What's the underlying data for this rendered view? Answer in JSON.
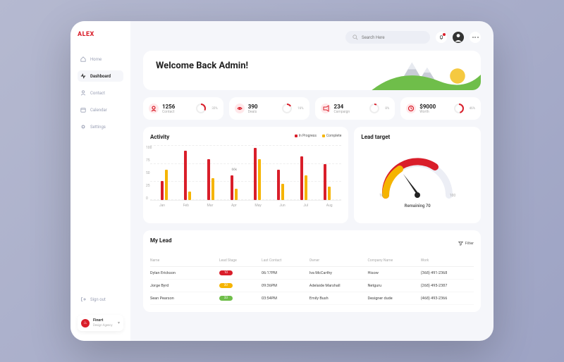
{
  "brand": "ALEX",
  "nav": {
    "home": "Home",
    "dashboard": "Dashboard",
    "contact": "Contact",
    "calendar": "Calendar",
    "settings": "Settings",
    "signout": "Sign out"
  },
  "agency": {
    "name": "Finsrt",
    "sub": "Design Agency"
  },
  "search": {
    "placeholder": "Search Here"
  },
  "hero": {
    "title": "Welcome Back Admin!"
  },
  "stats": [
    {
      "value": "1256",
      "label": "Contact",
      "pct": "32%"
    },
    {
      "value": "390",
      "label": "Deals",
      "pct": "16%"
    },
    {
      "value": "234",
      "label": "Campaign",
      "pct": "8%"
    },
    {
      "value": "$9000",
      "label": "Worth",
      "pct": "46%"
    }
  ],
  "activity": {
    "title": "Activity",
    "legend": {
      "a": "In Progress",
      "b": "Complete"
    },
    "tip": "66k"
  },
  "target": {
    "title": "Lead target",
    "remaining": "Remaining 70"
  },
  "leads": {
    "title": "My Lead",
    "filter": "Filter",
    "columns": {
      "name": "Name",
      "stage": "Lead Stage",
      "last": "Last Contact",
      "owner": "Owner",
      "company": "Company Name",
      "work": "Work"
    },
    "rows": [
      {
        "name": "Dylan Erickson",
        "stage": "10",
        "stageColor": "#d91e2a",
        "last": "06:17PM",
        "owner": "Iva McCarthy",
        "company": "Hisow",
        "work": "(368) 491-2368"
      },
      {
        "name": "Jorge Byrd",
        "stage": "20",
        "stageColor": "#f5b400",
        "last": "09:36PM",
        "owner": "Adelaide Marshall",
        "company": "Netguru",
        "work": "(268) 495-2387"
      },
      {
        "name": "Sean Pearson",
        "stage": "33",
        "stageColor": "#6fbe4a",
        "last": "03:54PM",
        "owner": "Emily Bush",
        "company": "Designer dude",
        "work": "(468) 493-2366"
      }
    ]
  },
  "gauge": {
    "min": "10",
    "max": "100"
  },
  "chart_data": {
    "type": "bar",
    "title": "Activity",
    "ylabel": "",
    "ylim": [
      0,
      100
    ],
    "yticks": [
      0,
      25,
      50,
      75,
      100
    ],
    "categories": [
      "Jan",
      "Feb",
      "Mar",
      "Apr",
      "May",
      "Jun",
      "Jul",
      "Aug"
    ],
    "series": [
      {
        "name": "In Progress",
        "color": "#d91e2a",
        "values": [
          35,
          90,
          75,
          45,
          95,
          55,
          80,
          65
        ]
      },
      {
        "name": "Complete",
        "color": "#f5b400",
        "values": [
          55,
          15,
          40,
          20,
          75,
          30,
          45,
          25
        ]
      }
    ],
    "annotation": {
      "category": "Apr",
      "text": "66k"
    }
  }
}
